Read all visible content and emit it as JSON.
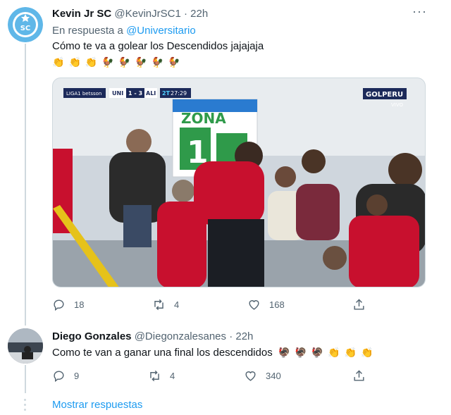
{
  "colors": {
    "link": "#1d9bf0",
    "muted": "#536471",
    "accent_red": "#c8102e",
    "like": "#536471"
  },
  "tweet1": {
    "display_name": "Kevin Jr SC",
    "handle": "@KevinJrSC1",
    "sep": "·",
    "time": "22h",
    "more": "···",
    "reply_prefix": "En respuesta a",
    "reply_to": "@Universitario",
    "text": "Cómo te va a golear  los Descendidos jajajaja",
    "emojis": [
      "👏",
      "👏",
      "👏",
      "🐓",
      "🐓",
      "🐓",
      "🐓",
      "🐓"
    ],
    "media": {
      "score_left_tag": "LIGA1 betsson",
      "team_home": "UNI",
      "score": "1 - 3",
      "team_away": "ALI",
      "period": "2T",
      "clock": "27:29",
      "broadcaster": "GOLPERU",
      "broadcaster_sub": "VIVO",
      "sign_text": "ZONA",
      "sign_number": "1"
    },
    "stats": {
      "replies": "18",
      "retweets": "4",
      "likes": "168"
    }
  },
  "tweet2": {
    "display_name": "Diego Gonzales",
    "handle": "@Diegonzalesanes",
    "sep": "·",
    "time": "22h",
    "text": "Como te van a ganar una final los descendidos",
    "emojis": [
      "🦃",
      "🦃",
      "🦃",
      "👏",
      "👏",
      "👏"
    ],
    "stats": {
      "replies": "9",
      "retweets": "4",
      "likes": "340"
    }
  },
  "show_replies": "Mostrar respuestas"
}
